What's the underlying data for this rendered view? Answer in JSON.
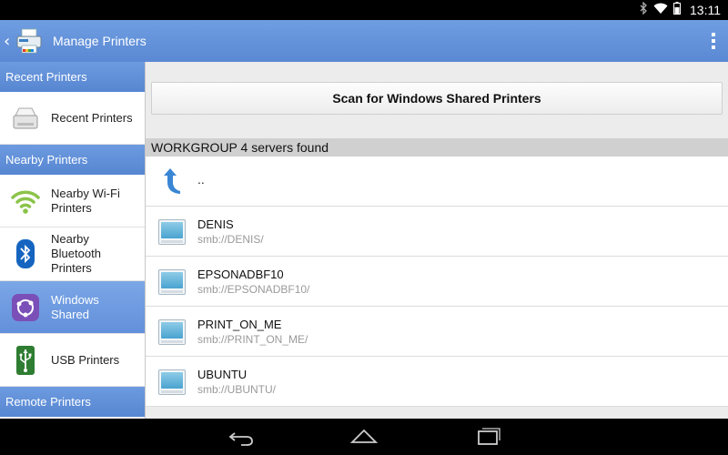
{
  "status_bar": {
    "time": "13:11",
    "icons": [
      "bluetooth-icon",
      "wifi-icon",
      "battery-icon"
    ]
  },
  "action_bar": {
    "title": "Manage Printers",
    "icons": [
      "back-arrow-icon",
      "printer-app-icon",
      "overflow-menu-icon"
    ]
  },
  "sidebar": {
    "sections": [
      {
        "header": "Recent Printers",
        "items": [
          {
            "label": "Recent Printers",
            "icon": "printer-icon"
          }
        ]
      },
      {
        "header": "Nearby Printers",
        "items": [
          {
            "label": "Nearby Wi-Fi Printers",
            "icon": "wifi-icon"
          },
          {
            "label": "Nearby Bluetooth Printers",
            "icon": "bluetooth-icon"
          },
          {
            "label": "Windows Shared",
            "icon": "network-share-icon",
            "selected": true
          },
          {
            "label": "USB Printers",
            "icon": "usb-icon"
          }
        ]
      },
      {
        "header": "Remote Printers",
        "items": []
      }
    ]
  },
  "main": {
    "scan_button": "Scan for Windows Shared Printers",
    "group_header": "WORKGROUP  4 servers found",
    "parent_entry": "..",
    "servers": [
      {
        "name": "DENIS",
        "url": "smb://DENIS/"
      },
      {
        "name": "EPSONADBF10",
        "url": "smb://EPSONADBF10/"
      },
      {
        "name": "PRINT_ON_ME",
        "url": "smb://PRINT_ON_ME/"
      },
      {
        "name": "UBUNTU",
        "url": "smb://UBUNTU/"
      }
    ]
  },
  "nav_bar": {
    "icons": [
      "back-icon",
      "home-icon",
      "recent-apps-icon"
    ]
  },
  "colors": {
    "accent": "#5f8ed7",
    "selected": "#6d9ae0",
    "list_bg": "#ffffff",
    "group_header_bg": "#d0d0d0"
  }
}
